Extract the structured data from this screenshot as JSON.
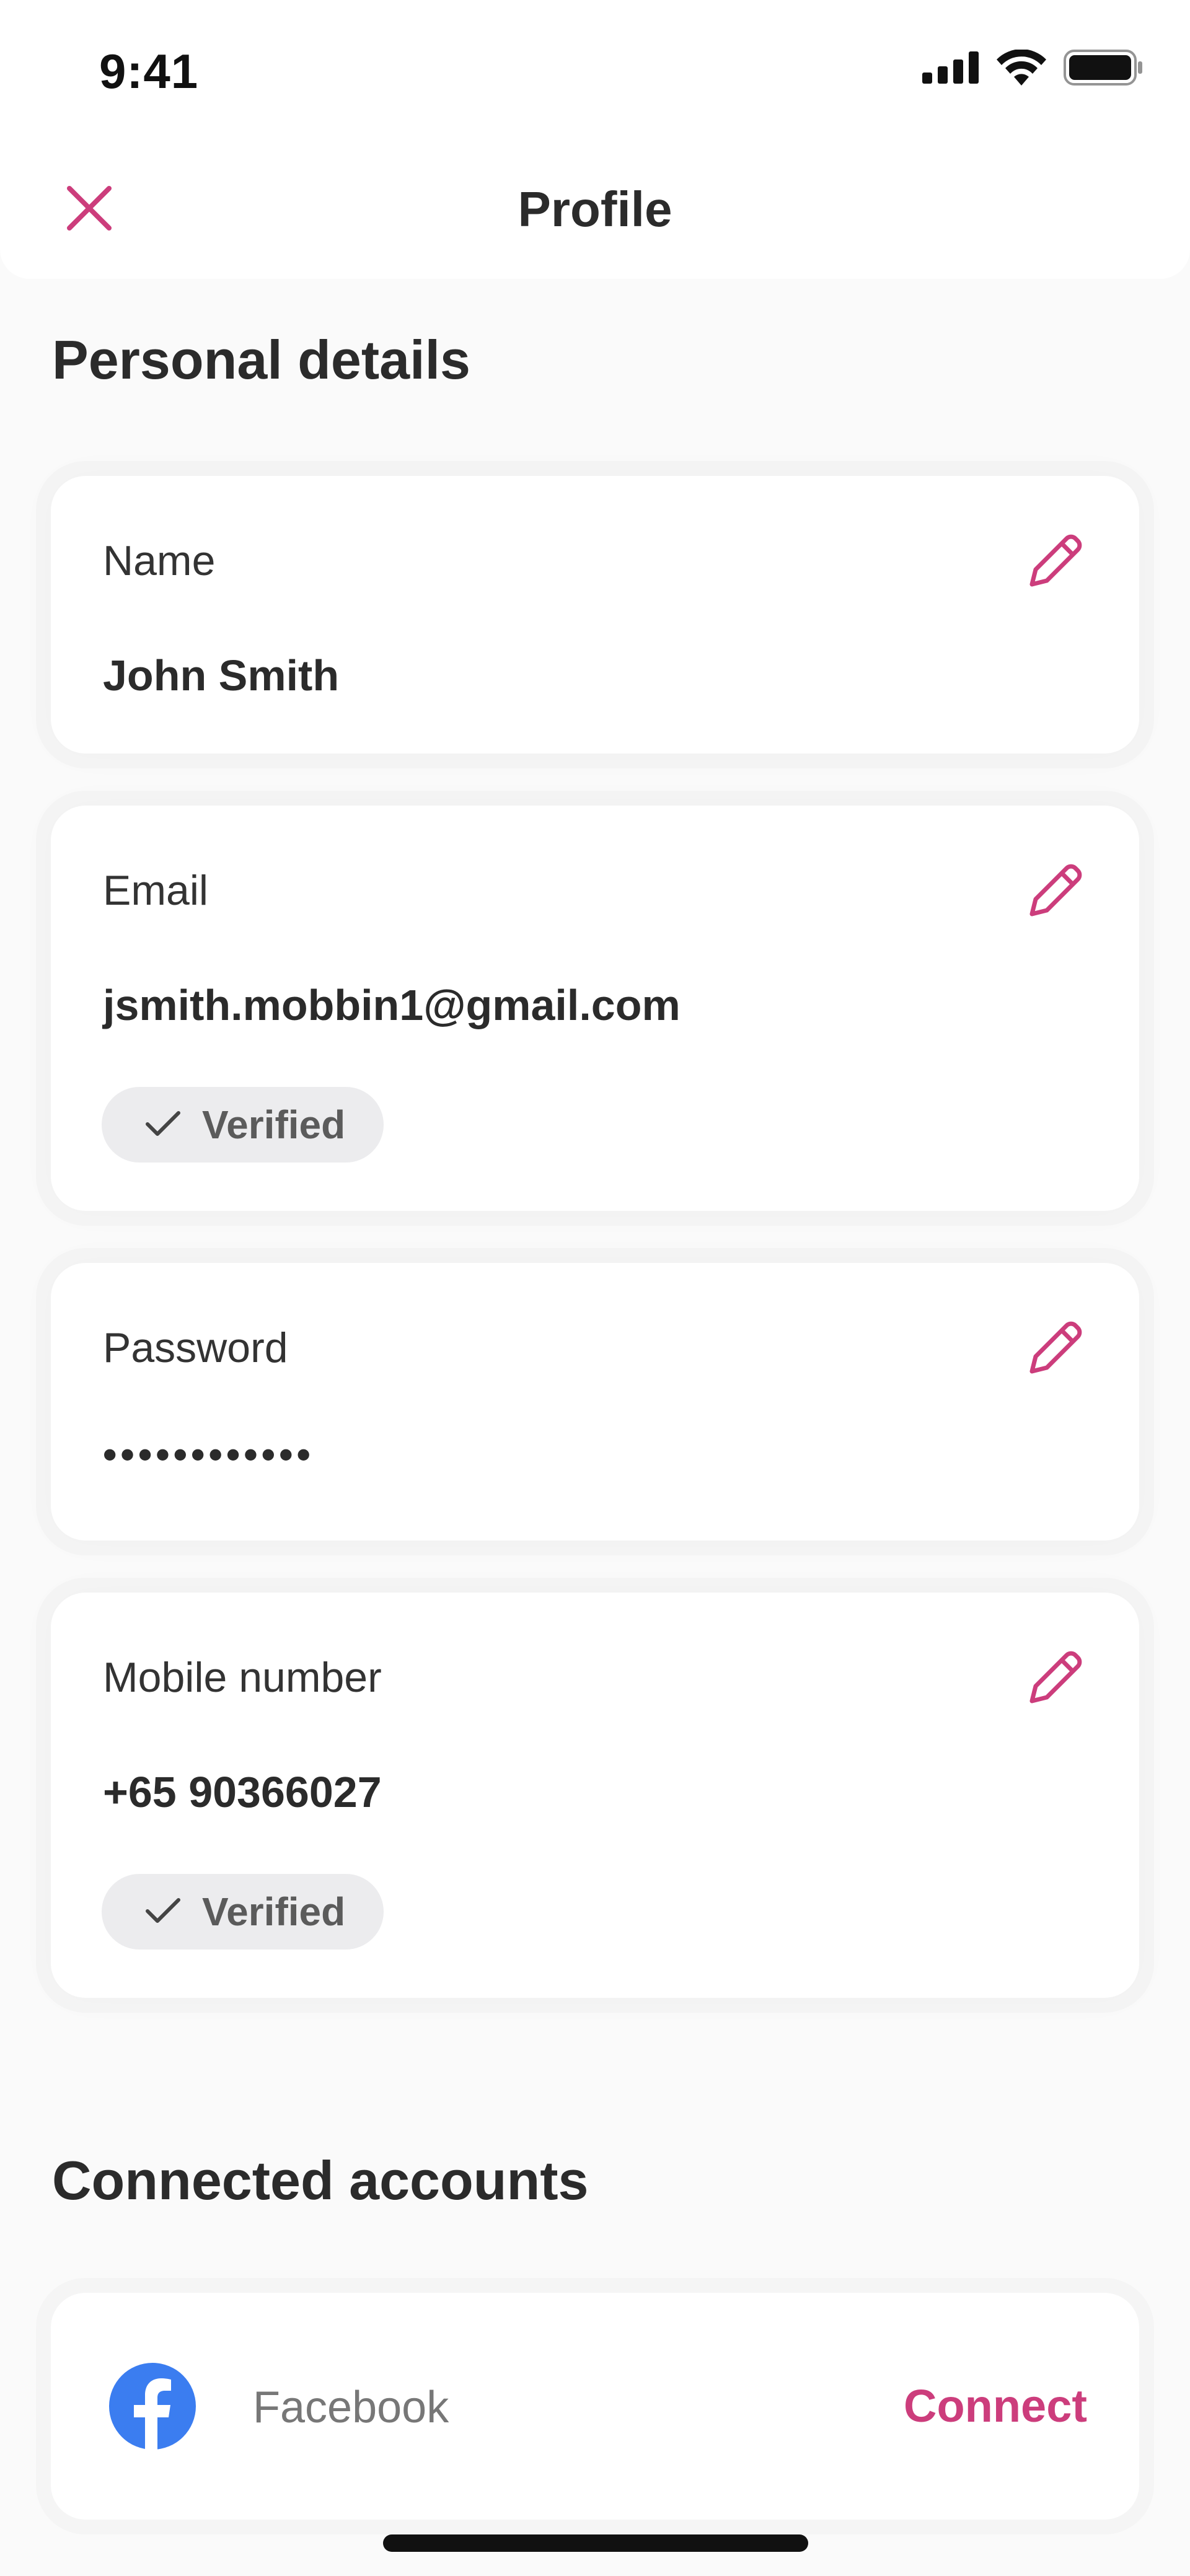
{
  "status_bar": {
    "time": "9:41",
    "icons": [
      "cellular-signal-icon",
      "wifi-icon",
      "battery-icon"
    ]
  },
  "header": {
    "title": "Profile",
    "close_icon": "close-icon"
  },
  "personal_details": {
    "heading": "Personal details",
    "fields": [
      {
        "label": "Name",
        "value": "John Smith"
      },
      {
        "label": "Email",
        "value": "jsmith.mobbin1@gmail.com",
        "badge": "Verified"
      },
      {
        "label": "Password",
        "value": "••••••••••••"
      },
      {
        "label": "Mobile number",
        "value": "+65 90366027",
        "badge": "Verified"
      }
    ]
  },
  "connected_accounts": {
    "heading": "Connected accounts",
    "accounts": [
      {
        "name": "Facebook",
        "action": "Connect",
        "icon": "facebook-logo-icon"
      }
    ]
  },
  "colors": {
    "accent": "#cc3d7c",
    "facebook_blue": "#3b7df0",
    "background": "#fafafa",
    "card": "#ffffff",
    "badge_bg": "#ececee"
  }
}
